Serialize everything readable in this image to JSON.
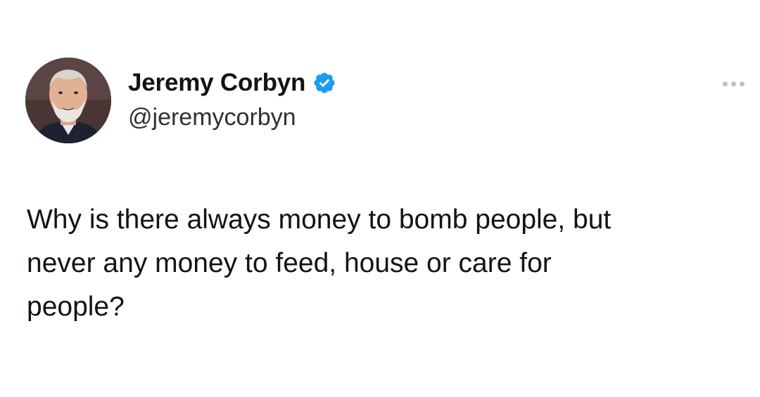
{
  "author": {
    "display_name": "Jeremy Corbyn",
    "handle": "@jeremycorbyn",
    "verified": true,
    "avatar_icon": "profile-photo",
    "verified_icon": "verified-badge-icon"
  },
  "tweet": {
    "text": "Why is there always money to bomb people, but\nnever any money to feed, house or care for\npeople?"
  },
  "actions": {
    "more_icon": "more-options-icon"
  },
  "colors": {
    "verified_blue": "#1d9bf0",
    "text": "#0f1419",
    "handle": "#2b3137",
    "more_dots": "#b6c2cc"
  }
}
